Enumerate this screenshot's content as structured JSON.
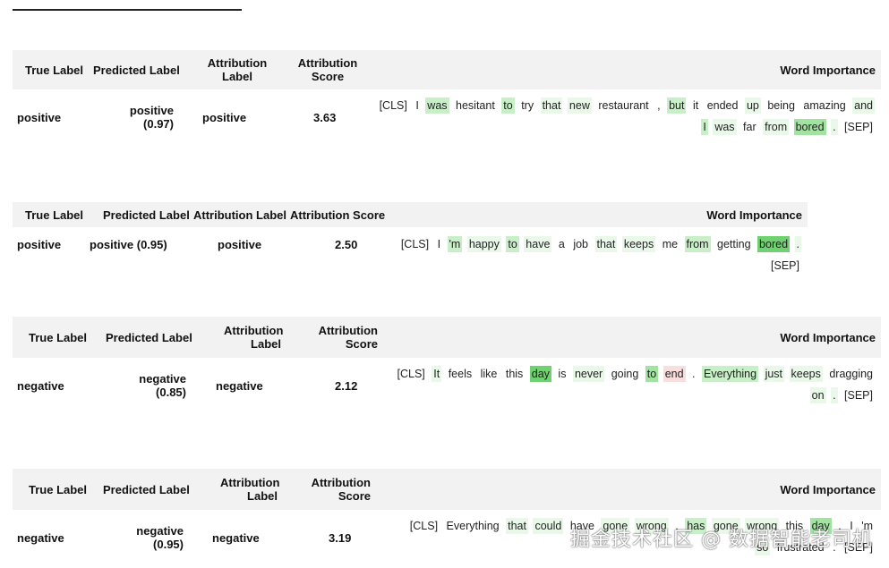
{
  "tables": [
    {
      "headers": [
        "True Label",
        "Predicted Label",
        "Attribution Label",
        "Attribution Score",
        "Word Importance"
      ],
      "true_label": "positive",
      "predicted_label": "positive (0.97)",
      "attribution_label": "positive",
      "attribution_score": "3.63",
      "tokens": [
        {
          "t": "[CLS]",
          "c": "n"
        },
        {
          "t": "I",
          "c": "n"
        },
        {
          "t": "was",
          "c": "g2"
        },
        {
          "t": "hesitant",
          "c": "n"
        },
        {
          "t": "to",
          "c": "g2"
        },
        {
          "t": "try",
          "c": "n"
        },
        {
          "t": "that",
          "c": "g1"
        },
        {
          "t": "new",
          "c": "g1"
        },
        {
          "t": "restaurant",
          "c": "n"
        },
        {
          "t": ",",
          "c": "n"
        },
        {
          "t": "but",
          "c": "g2"
        },
        {
          "t": "it",
          "c": "n"
        },
        {
          "t": "ended",
          "c": "n"
        },
        {
          "t": "up",
          "c": "g1"
        },
        {
          "t": "being",
          "c": "n"
        },
        {
          "t": "amazing",
          "c": "n"
        },
        {
          "t": "and",
          "c": "g1"
        },
        {
          "t": "I",
          "c": "g2"
        },
        {
          "t": "was",
          "c": "g1"
        },
        {
          "t": "far",
          "c": "n"
        },
        {
          "t": "from",
          "c": "g1"
        },
        {
          "t": "bored",
          "c": "g3"
        },
        {
          "t": ".",
          "c": "g1"
        },
        {
          "t": "[SEP]",
          "c": "n"
        }
      ]
    },
    {
      "headers": [
        "True Label",
        "Predicted Label",
        "Attribution Label",
        "Attribution Score",
        "Word Importance"
      ],
      "true_label": "positive",
      "predicted_label": "positive (0.95)",
      "attribution_label": "positive",
      "attribution_score": "2.50",
      "tokens": [
        {
          "t": "[CLS]",
          "c": "n"
        },
        {
          "t": "I",
          "c": "n"
        },
        {
          "t": "'m",
          "c": "g2"
        },
        {
          "t": "happy",
          "c": "g1"
        },
        {
          "t": "to",
          "c": "g2"
        },
        {
          "t": "have",
          "c": "g1"
        },
        {
          "t": "a",
          "c": "n"
        },
        {
          "t": "job",
          "c": "n"
        },
        {
          "t": "that",
          "c": "g1"
        },
        {
          "t": "keeps",
          "c": "g1"
        },
        {
          "t": "me",
          "c": "n"
        },
        {
          "t": "from",
          "c": "g2"
        },
        {
          "t": "getting",
          "c": "n"
        },
        {
          "t": "bored",
          "c": "g4"
        },
        {
          "t": ".",
          "c": "g1"
        },
        {
          "t": "[SEP]",
          "c": "n"
        }
      ]
    },
    {
      "headers": [
        "True Label",
        "Predicted Label",
        "Attribution Label",
        "Attribution Score",
        "Word Importance"
      ],
      "true_label": "negative",
      "predicted_label": "negative (0.85)",
      "attribution_label": "negative",
      "attribution_score": "2.12",
      "tokens": [
        {
          "t": "[CLS]",
          "c": "n"
        },
        {
          "t": "It",
          "c": "g1"
        },
        {
          "t": "feels",
          "c": "n"
        },
        {
          "t": "like",
          "c": "n"
        },
        {
          "t": "this",
          "c": "n"
        },
        {
          "t": "day",
          "c": "g4"
        },
        {
          "t": "is",
          "c": "n"
        },
        {
          "t": "never",
          "c": "g1"
        },
        {
          "t": "going",
          "c": "n"
        },
        {
          "t": "to",
          "c": "g3"
        },
        {
          "t": "end",
          "c": "p1"
        },
        {
          "t": ".",
          "c": "n"
        },
        {
          "t": "Everything",
          "c": "g2"
        },
        {
          "t": "just",
          "c": "g1"
        },
        {
          "t": "keeps",
          "c": "g1"
        },
        {
          "t": "dragging",
          "c": "n"
        },
        {
          "t": "on",
          "c": "g1"
        },
        {
          "t": ".",
          "c": "g1"
        },
        {
          "t": "[SEP]",
          "c": "n"
        }
      ]
    },
    {
      "headers": [
        "True Label",
        "Predicted Label",
        "Attribution Label",
        "Attribution Score",
        "Word Importance"
      ],
      "true_label": "negative",
      "predicted_label": "negative (0.95)",
      "attribution_label": "negative",
      "attribution_score": "3.19",
      "tokens": [
        {
          "t": "[CLS]",
          "c": "n"
        },
        {
          "t": "Everything",
          "c": "n"
        },
        {
          "t": "that",
          "c": "g1"
        },
        {
          "t": "could",
          "c": "g1"
        },
        {
          "t": "have",
          "c": "n"
        },
        {
          "t": "gone",
          "c": "g1"
        },
        {
          "t": "wrong",
          "c": "g1"
        },
        {
          "t": ",",
          "c": "n"
        },
        {
          "t": "has",
          "c": "g2"
        },
        {
          "t": "gone",
          "c": "g1"
        },
        {
          "t": "wrong",
          "c": "g1"
        },
        {
          "t": "this",
          "c": "n"
        },
        {
          "t": "day",
          "c": "g3"
        },
        {
          "t": ".",
          "c": "n"
        },
        {
          "t": "I",
          "c": "n"
        },
        {
          "t": "'m",
          "c": "n"
        },
        {
          "t": "so",
          "c": "g1"
        },
        {
          "t": "frustrated",
          "c": "n"
        },
        {
          "t": ".",
          "c": "n"
        },
        {
          "t": "[SEP]",
          "c": "n"
        }
      ]
    }
  ],
  "watermark": "掘金技术社区 @ 数据智能老司机"
}
